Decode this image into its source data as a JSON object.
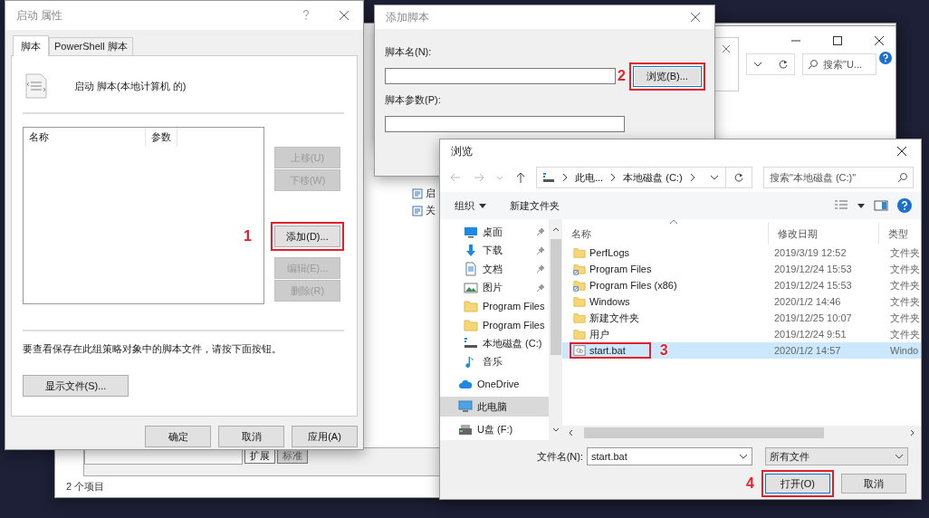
{
  "background_window": {
    "items": [
      {
        "label": "启"
      },
      {
        "label": "关"
      }
    ],
    "tabs": [
      {
        "label": "扩展",
        "selected": true
      },
      {
        "label": "标准",
        "selected": false
      }
    ],
    "status": "2 个项目"
  },
  "explorer_window": {
    "search_placeholder": "搜索\"U..."
  },
  "properties_dialog": {
    "title": "启动 属性",
    "tabs": [
      {
        "label": "脚本",
        "selected": true
      },
      {
        "label": "PowerShell 脚本",
        "selected": false
      }
    ],
    "heading": "启动 脚本(本地计算机 的)",
    "columns": [
      "名称",
      "参数"
    ],
    "side_buttons": [
      {
        "label": "上移(U)",
        "disabled": true
      },
      {
        "label": "下移(W)",
        "disabled": true
      },
      {
        "label": "添加(D)...",
        "disabled": false,
        "marker": "1"
      },
      {
        "label": "编辑(E)...",
        "disabled": true
      },
      {
        "label": "删除(R)",
        "disabled": true
      }
    ],
    "note": "要查看保存在此组策略对象中的脚本文件，请按下面按钮。",
    "show_files_button": "显示文件(S)...",
    "buttons": [
      "确定",
      "取消",
      "应用(A)"
    ]
  },
  "add_script_dialog": {
    "title": "添加脚本",
    "fields": [
      {
        "label": "脚本名(N):"
      },
      {
        "label": "脚本参数(P):"
      }
    ],
    "browse_button": {
      "label": "浏览(B)...",
      "marker": "2"
    }
  },
  "browse_dialog": {
    "title": "浏览",
    "breadcrumb": [
      "此电...",
      "本地磁盘 (C:)"
    ],
    "search_placeholder": "搜索\"本地磁盘 (C:)\"",
    "toolbar": [
      "组织",
      "新建文件夹"
    ],
    "nav_groups": [
      {
        "items": [
          {
            "label": "桌面",
            "kind": "desktop",
            "pinned": true,
            "selected": false
          },
          {
            "label": "下载",
            "kind": "download",
            "pinned": true,
            "selected": false
          },
          {
            "label": "文档",
            "kind": "document",
            "pinned": true,
            "selected": false
          },
          {
            "label": "图片",
            "kind": "picture",
            "pinned": true,
            "selected": false
          },
          {
            "label": "Program Files",
            "kind": "folder",
            "pinned": false,
            "selected": false
          },
          {
            "label": "Program Files",
            "kind": "folder",
            "pinned": false,
            "selected": false
          },
          {
            "label": "本地磁盘 (C:)",
            "kind": "drive",
            "pinned": false,
            "selected": false
          },
          {
            "label": "音乐",
            "kind": "music",
            "pinned": false,
            "selected": false
          }
        ]
      },
      {
        "items": [
          {
            "label": "OneDrive",
            "kind": "cloud",
            "pinned": false,
            "selected": false
          }
        ]
      },
      {
        "items": [
          {
            "label": "此电脑",
            "kind": "pc",
            "pinned": false,
            "selected": true
          }
        ]
      },
      {
        "items": [
          {
            "label": "U盘 (F:)",
            "kind": "usb",
            "pinned": false,
            "selected": false
          }
        ]
      }
    ],
    "columns": [
      "名称",
      "修改日期",
      "类型"
    ],
    "rows": [
      {
        "name": "PerfLogs",
        "date": "2019/3/19 12:52",
        "type": "文件夹",
        "kind": "folder",
        "selected": false
      },
      {
        "name": "Program Files",
        "date": "2019/12/24 15:53",
        "type": "文件夹",
        "kind": "shortcut",
        "selected": false
      },
      {
        "name": "Program Files (x86)",
        "date": "2019/12/24 15:53",
        "type": "文件夹",
        "kind": "shortcut",
        "selected": false
      },
      {
        "name": "Windows",
        "date": "2020/1/2 14:46",
        "type": "文件夹",
        "kind": "folder",
        "selected": false
      },
      {
        "name": "新建文件夹",
        "date": "2019/12/25 10:07",
        "type": "文件夹",
        "kind": "folder",
        "selected": false
      },
      {
        "name": "用户",
        "date": "2019/12/24 9:51",
        "type": "文件夹",
        "kind": "folder",
        "selected": false
      },
      {
        "name": "start.bat",
        "date": "2020/1/2 14:57",
        "type": "Windo",
        "kind": "batch",
        "selected": true,
        "marker": "3"
      }
    ],
    "filename_label": "文件名(N):",
    "filename": "start.bat",
    "filter": "所有文件",
    "buttons": [
      {
        "label": "打开(O)",
        "marker": "4"
      },
      {
        "label": "取消"
      }
    ]
  }
}
